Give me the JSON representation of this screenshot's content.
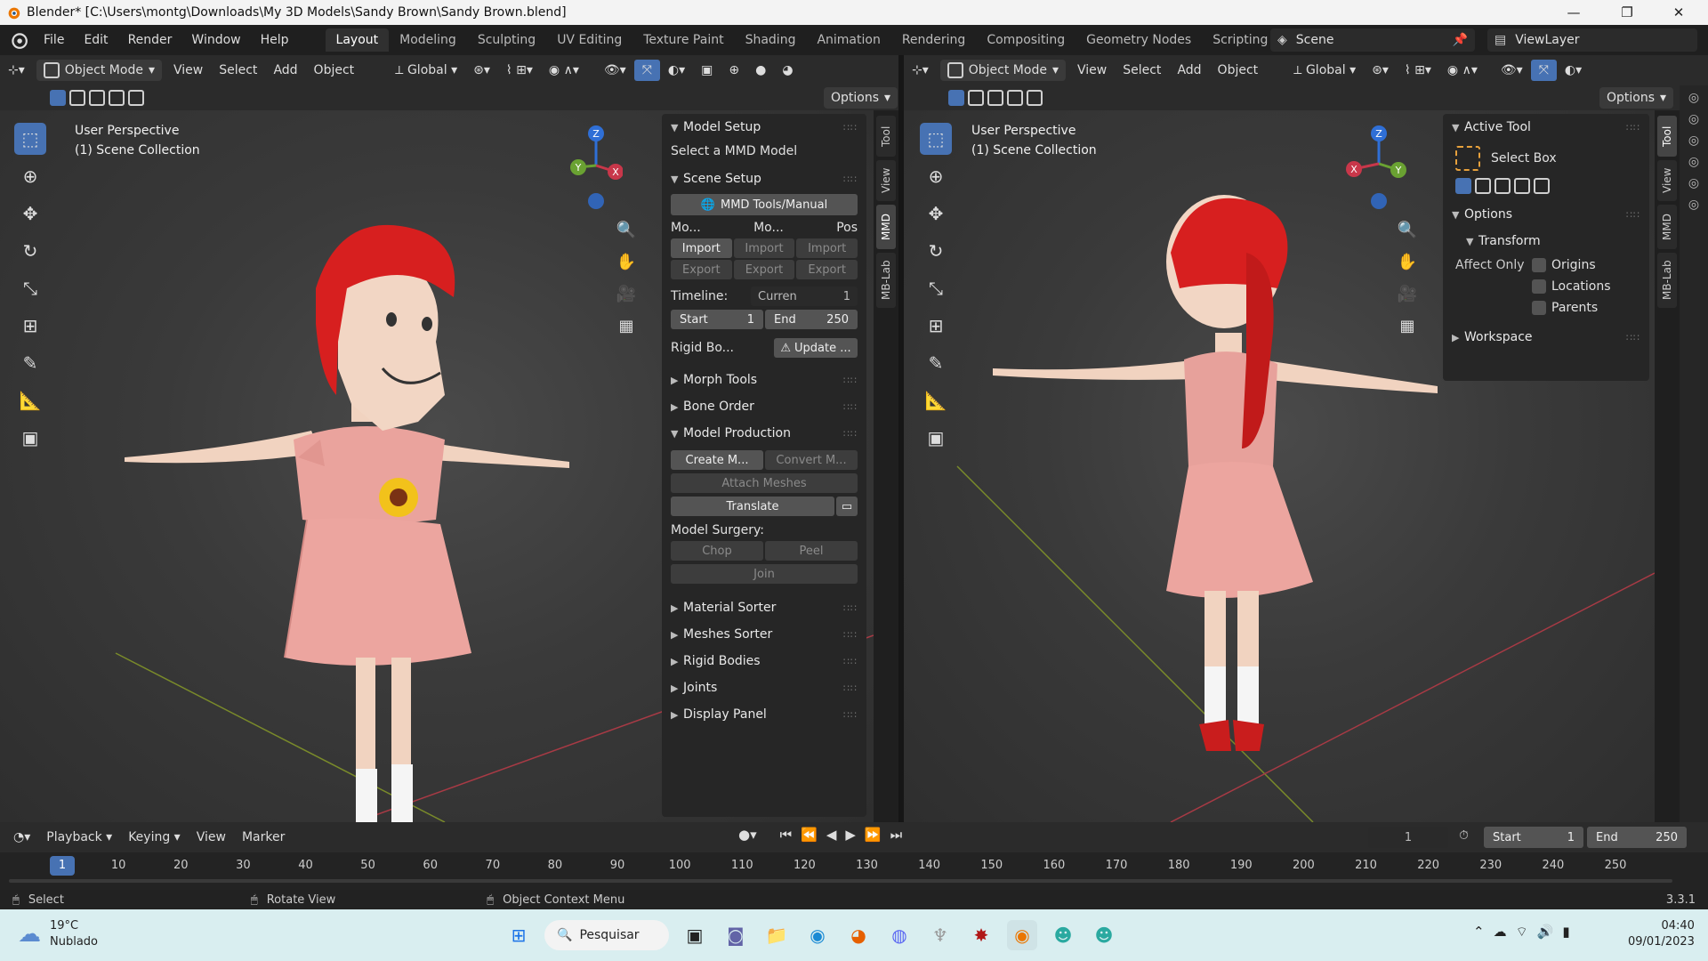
{
  "window": {
    "title": "Blender* [C:\\Users\\montg\\Downloads\\My 3D Models\\Sandy Brown\\Sandy Brown.blend]",
    "minimize": "—",
    "maximize": "❐",
    "close": "✕"
  },
  "menubar": {
    "menus": [
      "File",
      "Edit",
      "Render",
      "Window",
      "Help"
    ],
    "workspaces": [
      "Layout",
      "Modeling",
      "Sculpting",
      "UV Editing",
      "Texture Paint",
      "Shading",
      "Animation",
      "Rendering",
      "Compositing",
      "Geometry Nodes",
      "Scripting"
    ],
    "add_tab": "+",
    "scene": "Scene",
    "view_layer": "ViewLayer"
  },
  "left_view": {
    "mode": "Object Mode",
    "menus": [
      "View",
      "Select",
      "Add",
      "Object"
    ],
    "transform": "Global",
    "options": "Options",
    "perspective": "User Perspective",
    "collection": "(1) Scene Collection",
    "side_tabs": [
      "Tool",
      "View",
      "MMD",
      "MB-Lab"
    ]
  },
  "mmd_panel": {
    "model_setup": {
      "title": "Model Setup",
      "info": "Select a MMD Model"
    },
    "scene_setup": {
      "title": "Scene Setup",
      "manual": "MMD Tools/Manual",
      "cols": [
        "Mo...",
        "Mo...",
        "Pos"
      ],
      "import": "Import",
      "export": "Export",
      "timeline_label": "Timeline:",
      "current": "Curren",
      "current_val": "1",
      "start": "Start",
      "start_val": "1",
      "end": "End",
      "end_val": "250",
      "rigid": "Rigid Bo...",
      "update": "Update ..."
    },
    "collapsed_top": [
      "Morph Tools",
      "Bone Order"
    ],
    "model_production": {
      "title": "Model Production",
      "create": "Create M...",
      "convert": "Convert M...",
      "attach": "Attach Meshes",
      "translate": "Translate",
      "surgery": "Model Surgery:",
      "chop": "Chop",
      "peel": "Peel",
      "join": "Join"
    },
    "collapsed_bottom": [
      "Material Sorter",
      "Meshes Sorter",
      "Rigid Bodies",
      "Joints",
      "Display Panel"
    ]
  },
  "right_view": {
    "mode": "Object Mode",
    "menus": [
      "View",
      "Select",
      "Add",
      "Object"
    ],
    "transform": "Global",
    "options": "Options",
    "perspective": "User Perspective",
    "collection": "(1) Scene Collection",
    "side_tabs": [
      "Tool",
      "View",
      "MMD",
      "MB-Lab"
    ],
    "active_tool": {
      "title": "Active Tool",
      "tool": "Select Box"
    },
    "options_panel": {
      "title": "Options",
      "transform": "Transform",
      "affect_only": "Affect Only",
      "items": [
        "Origins",
        "Locations",
        "Parents"
      ]
    },
    "workspace": "Workspace"
  },
  "gizmo": {
    "x": "X",
    "y": "Y",
    "z": "Z"
  },
  "timeline": {
    "menus": [
      "Playback",
      "Keying",
      "View",
      "Marker"
    ],
    "current_frame": "1",
    "start_label": "Start",
    "start": "1",
    "end_label": "End",
    "end": "250",
    "ticks": [
      "1",
      "10",
      "20",
      "30",
      "40",
      "50",
      "60",
      "70",
      "80",
      "90",
      "100",
      "110",
      "120",
      "130",
      "140",
      "150",
      "160",
      "170",
      "180",
      "190",
      "200",
      "210",
      "220",
      "230",
      "240",
      "250"
    ]
  },
  "statusbar": {
    "select": "Select",
    "rotate": "Rotate View",
    "context": "Object Context Menu",
    "version": "3.3.1"
  },
  "taskbar": {
    "weather_temp": "19°C",
    "weather_desc": "Nublado",
    "search": "Pesquisar",
    "time": "04:40",
    "date": "09/01/2023"
  },
  "colors": {
    "accent": "#4772b3",
    "hair": "#d71f1f",
    "dress": "#e9a49e",
    "skin": "#f1d3c0",
    "x_axis": "#c8374a",
    "y_axis": "#6aa232",
    "z_axis": "#2f6fd6"
  }
}
